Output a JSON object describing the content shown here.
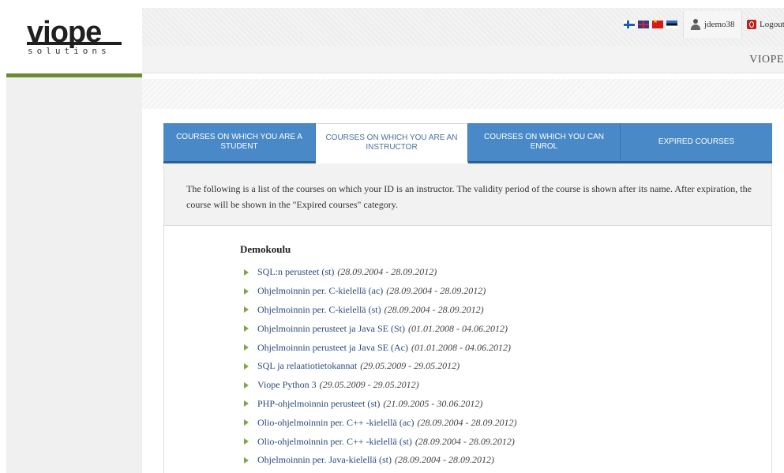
{
  "logo": {
    "word": "viope",
    "subtitle": "solutions"
  },
  "header": {
    "flags": [
      "finnish-flag-icon",
      "english-flag-icon",
      "chinese-flag-icon",
      "estonian-flag-icon"
    ],
    "username": "jdemo38",
    "logout_label": "Logout",
    "brand": "VIOPE"
  },
  "tabs": [
    {
      "label": "COURSES ON WHICH YOU ARE A STUDENT",
      "active": false
    },
    {
      "label": "COURSES ON WHICH YOU ARE AN INSTRUCTOR",
      "active": true
    },
    {
      "label": "COURSES ON WHICH YOU CAN ENROL",
      "active": false
    },
    {
      "label": "EXPIRED COURSES",
      "active": false
    }
  ],
  "info_text": "The following is a list of the courses on which your ID is an instructor. The validity period of the course is shown after its name. After expiration, the course will be shown in the \"Expired courses\" category.",
  "school": "Demokoulu",
  "courses": [
    {
      "name": "SQL:n perusteet (st)",
      "dates": "(28.09.2004 - 28.09.2012)"
    },
    {
      "name": "Ohjelmoinnin per. C-kielellä (ac)",
      "dates": "(28.09.2004 - 28.09.2012)"
    },
    {
      "name": "Ohjelmoinnin per. C-kielellä (st)",
      "dates": "(28.09.2004 - 28.09.2012)"
    },
    {
      "name": "Ohjelmoinnin perusteet ja Java SE (St)",
      "dates": "(01.01.2008 - 04.06.2012)"
    },
    {
      "name": "Ohjelmoinnin perusteet ja Java SE (Ac)",
      "dates": "(01.01.2008 - 04.06.2012)"
    },
    {
      "name": "SQL ja relaatiotietokannat",
      "dates": "(29.05.2009 - 29.05.2012)"
    },
    {
      "name": "Viope Python 3",
      "dates": "(29.05.2009 - 29.05.2012)"
    },
    {
      "name": "PHP-ohjelmoinnin perusteet (st)",
      "dates": "(21.09.2005 - 30.06.2012)"
    },
    {
      "name": "Olio-ohjelmoinnin per. C++ -kielellä (ac)",
      "dates": "(28.09.2004 - 28.09.2012)"
    },
    {
      "name": "Olio-ohjelmoinnin per. C++ -kielellä (st)",
      "dates": "(28.09.2004 - 28.09.2012)"
    },
    {
      "name": "Ohjelmoinnin per. Java-kielellä (st)",
      "dates": "(28.09.2004 - 28.09.2012)"
    }
  ],
  "colors": {
    "tab_blue": "#4a89c8",
    "accent_green": "#6b8b33",
    "link": "#2b4a78"
  }
}
